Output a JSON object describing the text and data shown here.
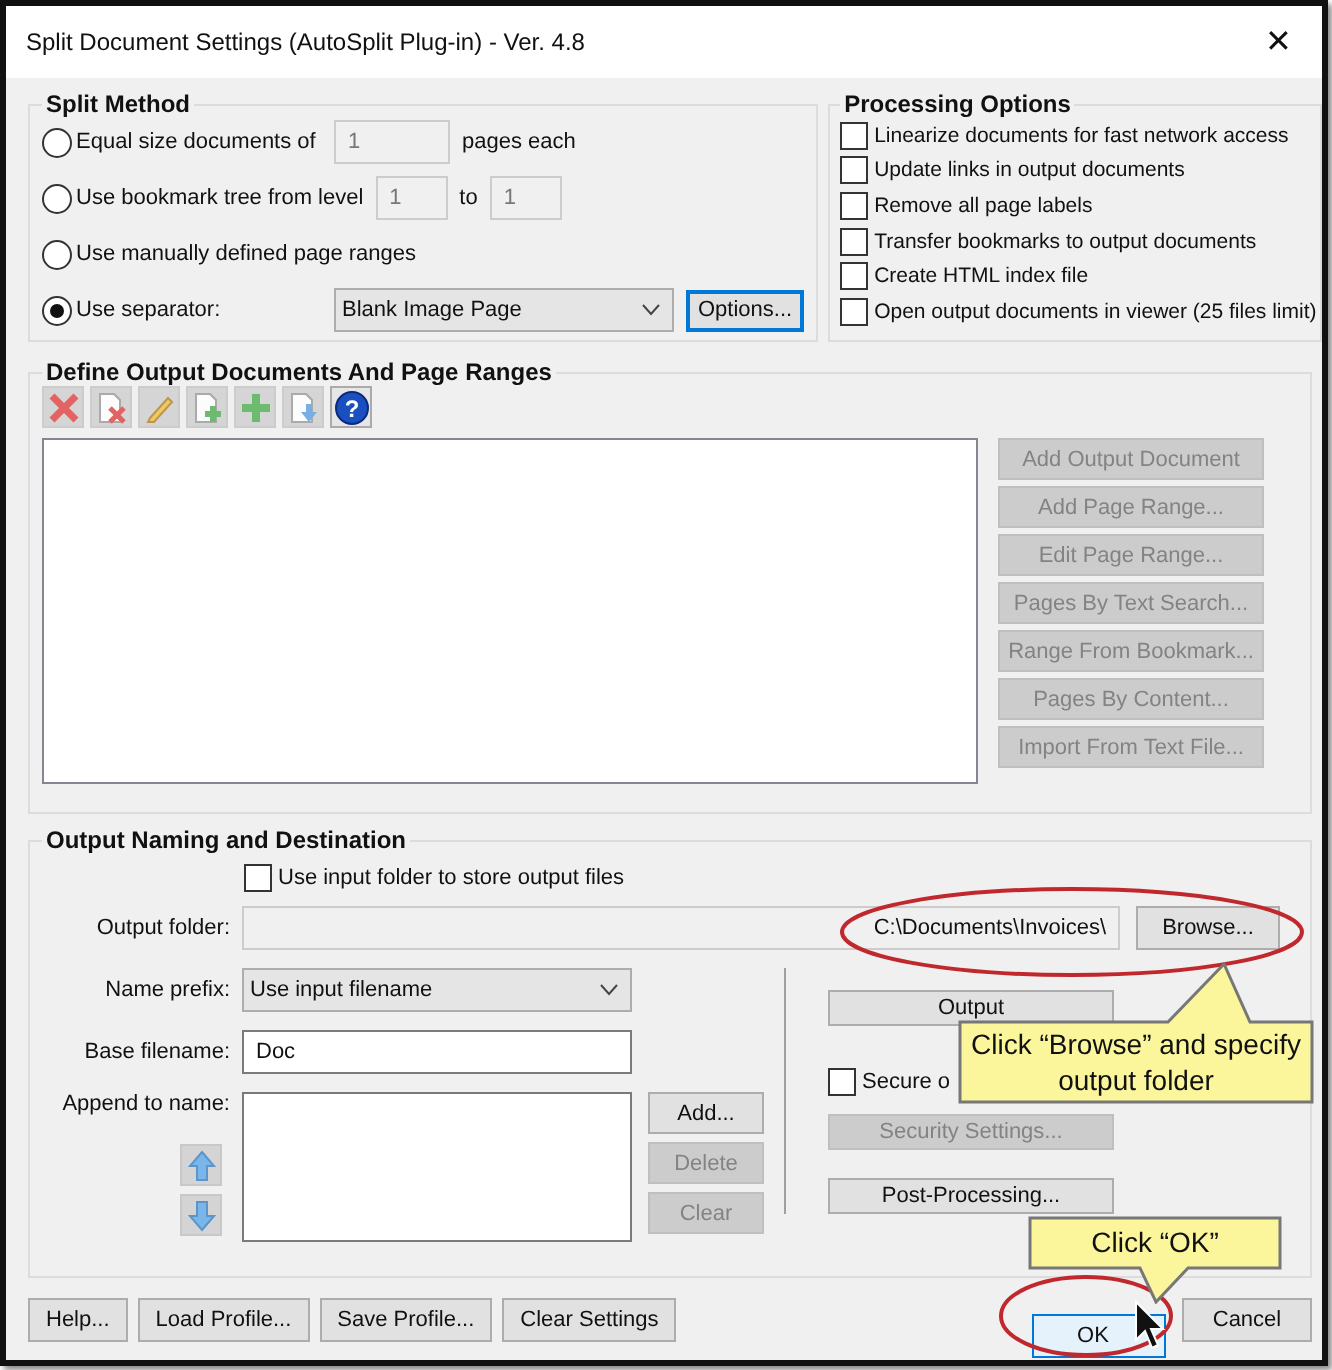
{
  "window": {
    "title": "Split Document Settings (AutoSplit Plug-in) - Ver. 4.8",
    "close": "✕"
  },
  "split_method": {
    "title": "Split Method",
    "options": [
      {
        "kind": "count",
        "label": "Equal size documents of",
        "selected": false,
        "value": "1",
        "suffix": "pages each"
      },
      {
        "kind": "range",
        "label": "Use bookmark tree from level",
        "selected": false,
        "from": "1",
        "to_label": "to",
        "to": "1"
      },
      {
        "kind": "plain",
        "label": "Use manually defined page ranges",
        "selected": false
      },
      {
        "kind": "separator",
        "label": "Use separator:",
        "selected": true,
        "dropdown": "Blank Image Page",
        "button": "Options..."
      }
    ]
  },
  "processing_options": {
    "title": "Processing Options",
    "items": [
      {
        "label": "Linearize documents for fast network access",
        "checked": false
      },
      {
        "label": "Update links in output documents",
        "checked": false
      },
      {
        "label": "Remove all page labels",
        "checked": false
      },
      {
        "label": "Transfer bookmarks to output documents",
        "checked": false
      },
      {
        "label": "Create HTML index file",
        "checked": false
      },
      {
        "label": "Open output documents in viewer (25 files limit)",
        "checked": false
      }
    ]
  },
  "define_output": {
    "title": "Define Output Documents And Page Ranges",
    "toolbar": [
      {
        "kind": "delete",
        "disabled": true
      },
      {
        "kind": "delete-page",
        "disabled": true
      },
      {
        "kind": "edit",
        "disabled": true
      },
      {
        "kind": "add-page",
        "disabled": true
      },
      {
        "kind": "add",
        "disabled": true
      },
      {
        "kind": "move",
        "disabled": true
      },
      {
        "kind": "help",
        "disabled": false,
        "glyph": "?"
      }
    ],
    "buttons": [
      {
        "label": "Add Output Document",
        "disabled": true
      },
      {
        "label": "Add Page Range...",
        "disabled": true
      },
      {
        "label": "Edit Page Range...",
        "disabled": true
      },
      {
        "label": "Pages By Text Search...",
        "disabled": true
      },
      {
        "label": "Range From Bookmark...",
        "disabled": true
      },
      {
        "label": "Pages By Content...",
        "disabled": true
      },
      {
        "label": "Import From Text File...",
        "disabled": true
      }
    ]
  },
  "output_naming": {
    "title": "Output Naming and Destination",
    "use_input_folder": {
      "label": "Use input folder to store output files",
      "checked": false
    },
    "output_folder": {
      "label": "Output folder:",
      "value": "C:\\Documents\\Invoices\\",
      "button": "Browse..."
    },
    "name_prefix": {
      "label": "Name prefix:",
      "value": "Use input filename"
    },
    "base_filename": {
      "label": "Base filename:",
      "value": "Doc"
    },
    "append": {
      "label": "Append to name:",
      "buttons": [
        {
          "label": "Add...",
          "disabled": false
        },
        {
          "label": "Delete",
          "disabled": true
        },
        {
          "label": "Clear",
          "disabled": true
        }
      ]
    },
    "output_options": {
      "label": "Output",
      "disabled": false
    },
    "secure": {
      "label": "Secure o",
      "checked": false
    },
    "security_settings": {
      "label": "Security Settings...",
      "disabled": true
    },
    "post_processing": {
      "label": "Post-Processing...",
      "disabled": false
    }
  },
  "footer": {
    "buttons": [
      {
        "label": "Help..."
      },
      {
        "label": "Load Profile..."
      },
      {
        "label": "Save Profile..."
      },
      {
        "label": "Clear Settings"
      }
    ],
    "ok": {
      "label": "OK",
      "default": true
    },
    "cancel": {
      "label": "Cancel"
    }
  },
  "callouts": [
    {
      "text": "Click “Browse” and specify output folder"
    },
    {
      "text": "Click “OK”"
    }
  ]
}
